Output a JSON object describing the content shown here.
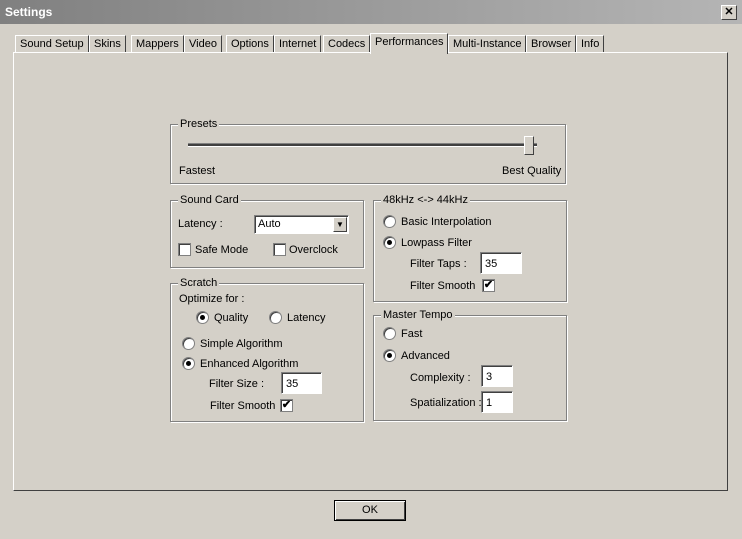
{
  "window": {
    "title": "Settings",
    "close_glyph": "✕"
  },
  "tabs": [
    {
      "label": "Sound Setup"
    },
    {
      "label": "Skins"
    },
    {
      "label": "Mappers"
    },
    {
      "label": "Video"
    },
    {
      "label": "Options"
    },
    {
      "label": "Internet"
    },
    {
      "label": "Codecs"
    },
    {
      "label": "Performances",
      "active": true
    },
    {
      "label": "Multi-Instance"
    },
    {
      "label": "Browser"
    },
    {
      "label": "Info"
    }
  ],
  "presets": {
    "title": "Presets",
    "left_label": "Fastest",
    "right_label": "Best Quality",
    "slider_level": 0.97
  },
  "sound_card": {
    "title": "Sound Card",
    "latency_label": "Latency :",
    "latency_value": "Auto",
    "safe_mode_label": "Safe Mode",
    "safe_mode_checked": false,
    "overclock_label": "Overclock",
    "overclock_checked": false
  },
  "scratch": {
    "title": "Scratch",
    "optimize_label": "Optimize for :",
    "quality_label": "Quality",
    "quality_selected": true,
    "latency_label": "Latency",
    "latency_selected": false,
    "simple_label": "Simple Algorithm",
    "simple_selected": false,
    "enhanced_label": "Enhanced Algorithm",
    "enhanced_selected": true,
    "filter_size_label": "Filter Size :",
    "filter_size_value": "35",
    "filter_smooth_label": "Filter Smooth",
    "filter_smooth_checked": true
  },
  "resample": {
    "title": "48kHz <-> 44kHz",
    "basic_label": "Basic Interpolation",
    "basic_selected": false,
    "lowpass_label": "Lowpass Filter",
    "lowpass_selected": true,
    "filter_taps_label": "Filter Taps :",
    "filter_taps_value": "35",
    "filter_smooth_label": "Filter Smooth",
    "filter_smooth_checked": true
  },
  "master_tempo": {
    "title": "Master Tempo",
    "fast_label": "Fast",
    "fast_selected": false,
    "advanced_label": "Advanced",
    "advanced_selected": true,
    "complexity_label": "Complexity :",
    "complexity_value": "3",
    "spatialization_label": "Spatialization :",
    "spatialization_value": "1"
  },
  "ok_label": "OK",
  "check_glyph": "✔",
  "dropdown_glyph": "▼"
}
